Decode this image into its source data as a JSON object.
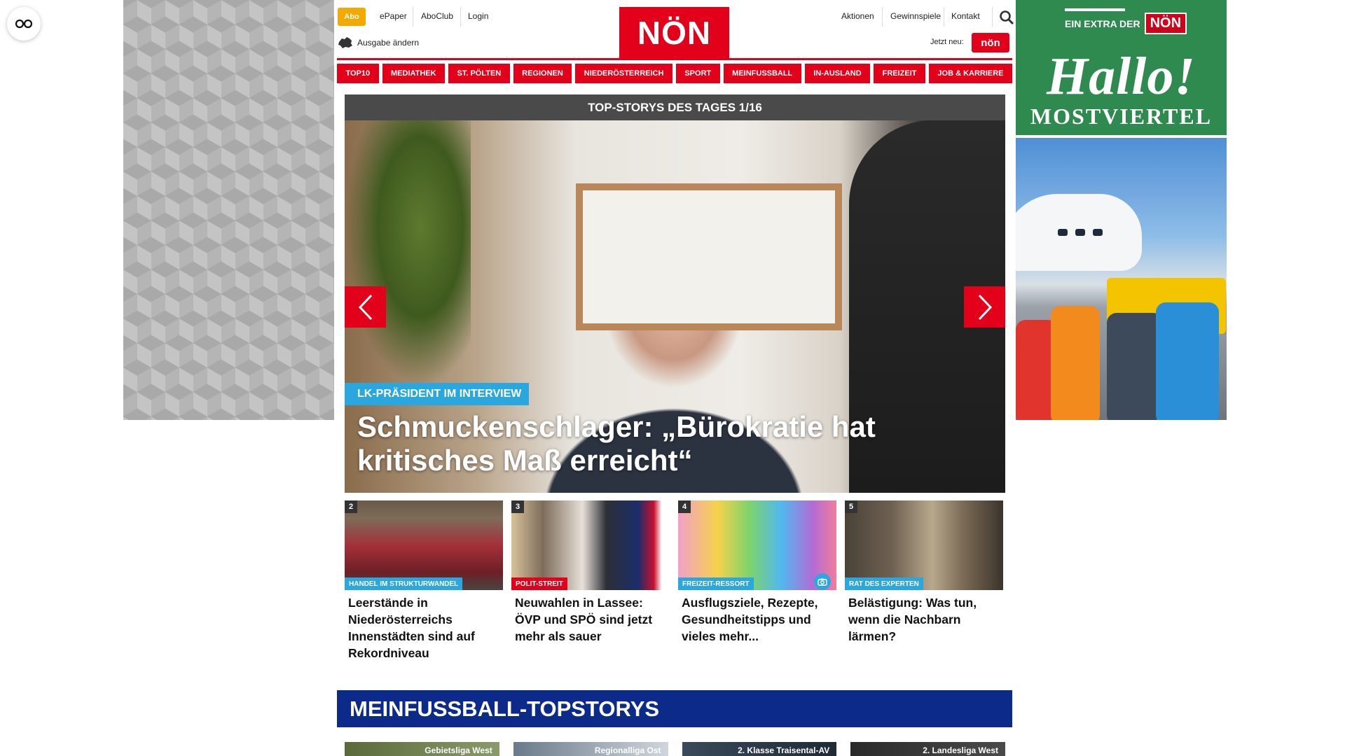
{
  "header": {
    "abo": "Abo",
    "links_left": [
      "ePaper",
      "AboClub",
      "Login"
    ],
    "logo": "NÖN",
    "ausgabe": "Ausgabe ändern",
    "links_right": [
      "Aktionen",
      "Gewinnspiele",
      "Kontakt"
    ],
    "jetzt_neu": "Jetzt neu:",
    "jetzt_logo": "nön"
  },
  "nav": [
    "TOP10",
    "MEDIATHEK",
    "ST. PÖLTEN",
    "REGIONEN",
    "NIEDERÖSTERREICH",
    "SPORT",
    "MEINFUSSBALL",
    "IN-AUSLAND",
    "FREIZEIT",
    "JOB & KARRIERE"
  ],
  "hero": {
    "heading": "TOP-STORYS DES TAGES 1/16",
    "tag": "LK-PRÄSIDENT IM INTERVIEW",
    "title": "Schmuckenschlager: „Bürokratie hat kritisches Maß erreicht“"
  },
  "stories": [
    {
      "num": "2",
      "tag": "HANDEL IM STRUKTURWANDEL",
      "tag_color": "#2aa7df",
      "title": "Leerstände in Niederösterreichs Innenstädten sind auf Rekordniveau"
    },
    {
      "num": "3",
      "tag": "POLIT-STREIT",
      "tag_color": "#e2001a",
      "title": "Neuwahlen in Lassee: ÖVP und SPÖ sind jetzt mehr als sauer"
    },
    {
      "num": "4",
      "tag": "FREIZEIT-RESSORT",
      "tag_color": "#2aa7df",
      "title": "Ausflugsziele, Rezepte, Gesundheitstipps und vieles mehr..."
    },
    {
      "num": "5",
      "tag": "RAT DES EXPERTEN",
      "tag_color": "#2aa7df",
      "title": "Belästigung: Was tun, wenn die Nachbarn lärmen?"
    }
  ],
  "fussball": {
    "heading": "MEINFUSSBALL-TOPSTORYS",
    "cards": [
      "Gebietsliga West",
      "Regionalliga Ost",
      "2. Klasse Traisental-AV",
      "2. Landesliga West"
    ]
  },
  "ad": {
    "extra": "EIN EXTRA DER",
    "logo": "NÖN",
    "hallo": "Hallo!",
    "region": "MOSTVIERTEL"
  },
  "colors": {
    "brand_red": "#e2001a",
    "accent_blue": "#2aa7df",
    "fussball_blue": "#0b2a8a",
    "abo_orange": "#f2a900"
  }
}
